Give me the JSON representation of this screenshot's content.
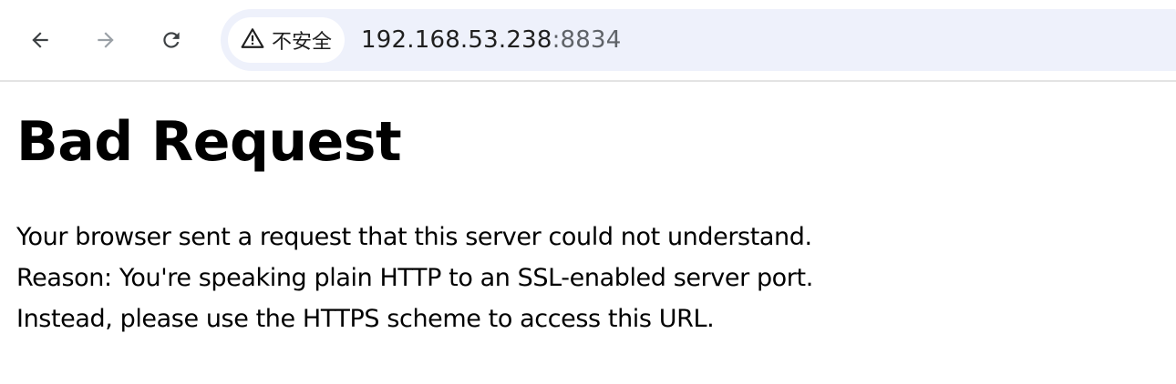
{
  "browser": {
    "nav": {
      "back_icon": "arrow-left-icon",
      "forward_icon": "arrow-right-icon",
      "reload_icon": "reload-icon"
    },
    "security": {
      "icon": "warning-triangle-icon",
      "label": "不安全"
    },
    "url": {
      "host": "192.168.53.238",
      "port": ":8834"
    },
    "colors": {
      "omnibox_bg": "#eef1fb",
      "disabled_icon": "#9aa0a6",
      "icon": "#3c4043"
    }
  },
  "page": {
    "heading": "Bad Request",
    "lines": [
      "Your browser sent a request that this server could not understand.",
      "Reason: You're speaking plain HTTP to an SSL-enabled server port.",
      "Instead, please use the HTTPS scheme to access this URL."
    ]
  }
}
